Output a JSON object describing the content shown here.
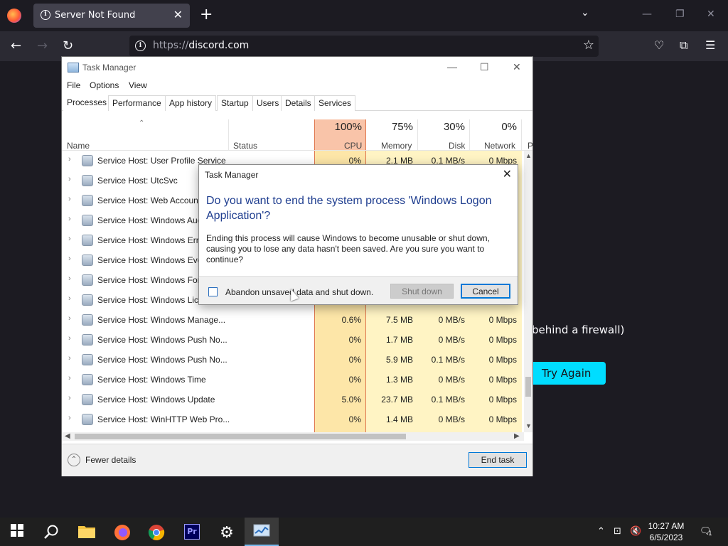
{
  "browser": {
    "tab_title": "Server Not Found",
    "url_scheme": "https://",
    "url_host": "discord.com",
    "icons": [
      "firefox-icon",
      "info-icon",
      "close-icon",
      "plus-icon",
      "chevron-down-icon",
      "minimize-icon",
      "restore-icon",
      "back-icon",
      "forward-icon",
      "reload-icon",
      "star-icon",
      "pocket-icon",
      "extensions-icon",
      "menu-icon"
    ]
  },
  "error_page": {
    "partial_text": "behind a firewall)",
    "try_again_label": "Try Again"
  },
  "task_manager": {
    "title": "Task Manager",
    "menu": [
      "File",
      "Options",
      "View"
    ],
    "tabs": [
      "Processes",
      "Performance",
      "App history",
      "Startup",
      "Users",
      "Details",
      "Services"
    ],
    "headers": {
      "name": "Name",
      "status": "Status",
      "cpu_pct": "100%",
      "cpu": "CPU",
      "mem_pct": "75%",
      "mem": "Memory",
      "disk_pct": "30%",
      "disk": "Disk",
      "net_pct": "0%",
      "net": "Network",
      "power": "P"
    },
    "rows": [
      {
        "name": "Service Host: User Profile Service",
        "cpu": "0%",
        "mem": "2.1 MB",
        "disk": "0.1 MB/s",
        "net": "0 Mbps"
      },
      {
        "name": "Service Host: UtcSvc",
        "cpu": "",
        "mem": "",
        "disk": "",
        "net": ""
      },
      {
        "name": "Service Host: Web Account",
        "cpu": "",
        "mem": "",
        "disk": "",
        "net": ""
      },
      {
        "name": "Service Host: Windows Aud",
        "cpu": "",
        "mem": "",
        "disk": "",
        "net": ""
      },
      {
        "name": "Service Host: Windows Erro",
        "cpu": "",
        "mem": "",
        "disk": "",
        "net": ""
      },
      {
        "name": "Service Host: Windows Eve",
        "cpu": "",
        "mem": "",
        "disk": "",
        "net": ""
      },
      {
        "name": "Service Host: Windows Fon",
        "cpu": "",
        "mem": "",
        "disk": "",
        "net": ""
      },
      {
        "name": "Service Host: Windows Lice",
        "cpu": "",
        "mem": "",
        "disk": "",
        "net": ""
      },
      {
        "name": "Service Host: Windows Manage...",
        "cpu": "0.6%",
        "mem": "7.5 MB",
        "disk": "0 MB/s",
        "net": "0 Mbps"
      },
      {
        "name": "Service Host: Windows Push No...",
        "cpu": "0%",
        "mem": "1.7 MB",
        "disk": "0 MB/s",
        "net": "0 Mbps"
      },
      {
        "name": "Service Host: Windows Push No...",
        "cpu": "0%",
        "mem": "5.9 MB",
        "disk": "0.1 MB/s",
        "net": "0 Mbps"
      },
      {
        "name": "Service Host: Windows Time",
        "cpu": "0%",
        "mem": "1.3 MB",
        "disk": "0 MB/s",
        "net": "0 Mbps"
      },
      {
        "name": "Service Host: Windows Update",
        "cpu": "5.0%",
        "mem": "23.7 MB",
        "disk": "0.1 MB/s",
        "net": "0 Mbps"
      },
      {
        "name": "Service Host: WinHTTP Web Pro...",
        "cpu": "0%",
        "mem": "1.4 MB",
        "disk": "0 MB/s",
        "net": "0 Mbps"
      }
    ],
    "fewer_details": "Fewer details",
    "end_task": "End task"
  },
  "dialog": {
    "title": "Task Manager",
    "question": "Do you want to end the system process 'Windows Logon Application'?",
    "message": "Ending this process will cause Windows to become unusable or shut down, causing you to lose any data hasn't been saved. Are you sure you want to continue?",
    "checkbox_label": "Abandon unsaved data and shut down.",
    "shutdown_label": "Shut down",
    "cancel_label": "Cancel"
  },
  "taskbar": {
    "apps": [
      "windows-start-icon",
      "search-icon",
      "file-explorer-icon",
      "firefox-icon",
      "chrome-icon",
      "premiere-icon",
      "settings-icon",
      "task-manager-icon"
    ],
    "premiere_text": "Pr",
    "time": "10:27 AM",
    "date": "6/5/2023",
    "notification_count": "1"
  }
}
